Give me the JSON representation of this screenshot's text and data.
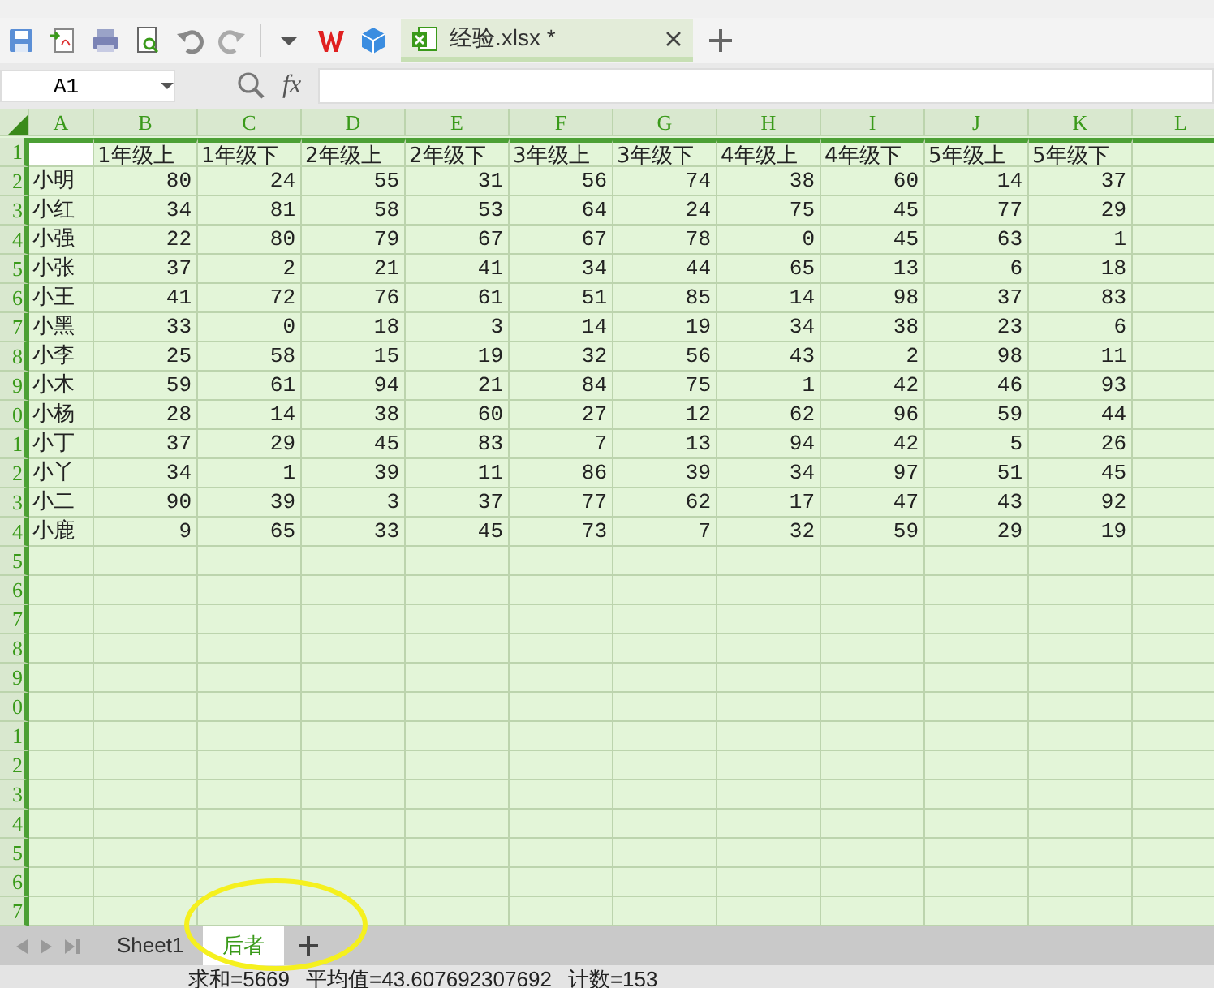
{
  "toolbar": {
    "file_tab": {
      "title": "经验.xlsx *",
      "selected": true
    }
  },
  "formula_bar": {
    "name_box": "A1",
    "fx": "fx"
  },
  "sheet": {
    "all_selected": true,
    "columns": [
      "A",
      "B",
      "C",
      "D",
      "E",
      "F",
      "G",
      "H",
      "I",
      "J",
      "K",
      "L"
    ],
    "header_row": {
      "number": "1",
      "labels": [
        "1年级上",
        "1年级下",
        "2年级上",
        "2年级下",
        "3年级上",
        "3年级下",
        "4年级上",
        "4年级下",
        "5年级上",
        "5年级下"
      ]
    },
    "rows": [
      {
        "number": "2",
        "name": "小明",
        "values": [
          "80",
          "24",
          "55",
          "31",
          "56",
          "74",
          "38",
          "60",
          "14",
          "37"
        ]
      },
      {
        "number": "3",
        "name": "小红",
        "values": [
          "34",
          "81",
          "58",
          "53",
          "64",
          "24",
          "75",
          "45",
          "77",
          "29"
        ]
      },
      {
        "number": "4",
        "name": "小强",
        "values": [
          "22",
          "80",
          "79",
          "67",
          "67",
          "78",
          "0",
          "45",
          "63",
          "1"
        ]
      },
      {
        "number": "5",
        "name": "小张",
        "values": [
          "37",
          "2",
          "21",
          "41",
          "34",
          "44",
          "65",
          "13",
          "6",
          "18"
        ]
      },
      {
        "number": "6",
        "name": "小王",
        "values": [
          "41",
          "72",
          "76",
          "61",
          "51",
          "85",
          "14",
          "98",
          "37",
          "83"
        ]
      },
      {
        "number": "7",
        "name": "小黑",
        "values": [
          "33",
          "0",
          "18",
          "3",
          "14",
          "19",
          "34",
          "38",
          "23",
          "6"
        ]
      },
      {
        "number": "8",
        "name": "小李",
        "values": [
          "25",
          "58",
          "15",
          "19",
          "32",
          "56",
          "43",
          "2",
          "98",
          "11"
        ]
      },
      {
        "number": "9",
        "name": "小木",
        "values": [
          "59",
          "61",
          "94",
          "21",
          "84",
          "75",
          "1",
          "42",
          "46",
          "93"
        ]
      },
      {
        "number": "0",
        "name": "小杨",
        "values": [
          "28",
          "14",
          "38",
          "60",
          "27",
          "12",
          "62",
          "96",
          "59",
          "44"
        ]
      },
      {
        "number": "1",
        "name": "小丁",
        "values": [
          "37",
          "29",
          "45",
          "83",
          "7",
          "13",
          "94",
          "42",
          "5",
          "26"
        ]
      },
      {
        "number": "2",
        "name": "小丫",
        "values": [
          "34",
          "1",
          "39",
          "11",
          "86",
          "39",
          "34",
          "97",
          "51",
          "45"
        ]
      },
      {
        "number": "3",
        "name": "小二",
        "values": [
          "90",
          "39",
          "3",
          "37",
          "77",
          "62",
          "17",
          "47",
          "43",
          "92"
        ]
      },
      {
        "number": "4",
        "name": "小鹿",
        "values": [
          "9",
          "65",
          "33",
          "45",
          "73",
          "7",
          "32",
          "59",
          "29",
          "19"
        ]
      }
    ],
    "empty_rows": [
      "5",
      "6",
      "7",
      "8",
      "9",
      "0",
      "1",
      "2",
      "3",
      "4",
      "5",
      "6",
      "7"
    ]
  },
  "sheet_tabs": [
    {
      "label": "Sheet1",
      "selected": false
    },
    {
      "label": "后者",
      "selected": true
    }
  ],
  "status_bar": {
    "sum": "求和=5669",
    "average": "平均值=43.607692307692",
    "count": "计数=153"
  }
}
